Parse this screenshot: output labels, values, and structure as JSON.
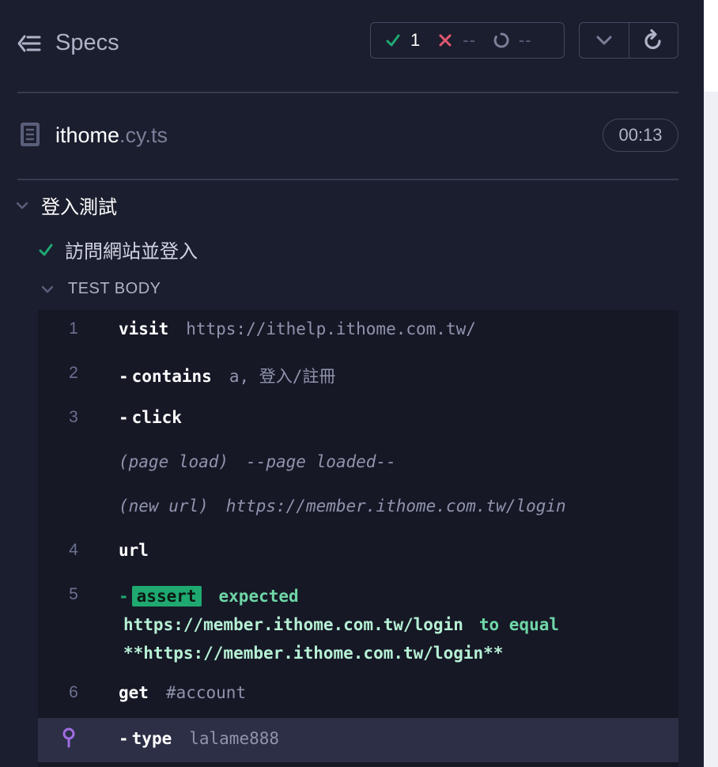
{
  "header": {
    "specs_label": "Specs",
    "passed_count": "1",
    "failed_count": "--",
    "pending_count": "--"
  },
  "spec_file": {
    "name": "ithome",
    "extension": ".cy.ts",
    "duration": "00:13"
  },
  "suite": {
    "title": "登入測試",
    "test": {
      "title": "訪問網站並登入",
      "status": "passed",
      "section_label": "TEST BODY",
      "commands": [
        {
          "number": "1",
          "dash": "",
          "name": "visit",
          "message": "https://ithelp.ithome.com.tw/"
        },
        {
          "number": "2",
          "dash": "-",
          "name": "contains",
          "message": "a, 登入/註冊"
        },
        {
          "number": "3",
          "dash": "-",
          "name": "click",
          "message": ""
        },
        {
          "number": "",
          "event": true,
          "name": "(page load)",
          "message": "--page loaded--"
        },
        {
          "number": "",
          "event": true,
          "name": "(new url)",
          "message": "https://member.ithome.com.tw/login"
        },
        {
          "number": "4",
          "dash": "",
          "name": "url",
          "message": ""
        },
        {
          "number": "5",
          "dash": "-",
          "name": "assert",
          "message_parts": [
            "expected",
            "https://member.ithome.com.tw/login",
            "to equal",
            "**https://member.ithome.com.tw/login**"
          ]
        },
        {
          "number": "6",
          "dash": "",
          "name": "get",
          "message": "#account"
        },
        {
          "number": "",
          "dash": "-",
          "name": "type",
          "message": "lalame888",
          "pinned": true
        }
      ]
    }
  },
  "colors": {
    "background": "#1b1e2e",
    "panel": "#161826",
    "pass": "#1fa971",
    "fail": "#e45770",
    "pinned_row": "#2c2f45",
    "pin_icon": "#a06ce4"
  }
}
